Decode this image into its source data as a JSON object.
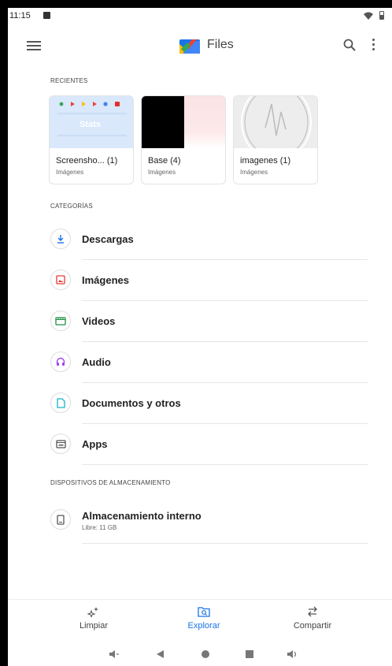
{
  "status_bar": {
    "time": "11:15"
  },
  "app_bar": {
    "title": "Files"
  },
  "recent": {
    "heading": "RECIENTES",
    "items": [
      {
        "name": "Screensho... (1)",
        "type": "Imágenes",
        "thumb_text": "Stats"
      },
      {
        "name": "Base (4)",
        "type": "Imágenes"
      },
      {
        "name": "imagenes (1)",
        "type": "Imágenes"
      }
    ]
  },
  "categories": {
    "heading": "CATEGORÍAS",
    "items": [
      {
        "label": "Descargas",
        "icon": "download-icon",
        "color": "#1a73e8"
      },
      {
        "label": "Imágenes",
        "icon": "image-icon",
        "color": "#e53935"
      },
      {
        "label": "Videos",
        "icon": "video-icon",
        "color": "#1e8e3e"
      },
      {
        "label": "Audio",
        "icon": "headphones-icon",
        "color": "#a142f4"
      },
      {
        "label": "Documentos y otros",
        "icon": "document-icon",
        "color": "#12b5cb"
      },
      {
        "label": "Apps",
        "icon": "apps-icon",
        "color": "#555555"
      }
    ]
  },
  "storage": {
    "heading": "DISPOSITIVOS DE ALMACENAMIENTO",
    "label": "Almacenamiento interno",
    "free": "Libre: 11 GB"
  },
  "bottom_nav": {
    "items": [
      {
        "label": "Limpiar",
        "icon": "sparkle-icon",
        "active": false
      },
      {
        "label": "Explorar",
        "icon": "browse-icon",
        "active": true
      },
      {
        "label": "Compartir",
        "icon": "swap-icon",
        "active": false
      }
    ]
  },
  "colors": {
    "accent": "#1a73e8"
  }
}
